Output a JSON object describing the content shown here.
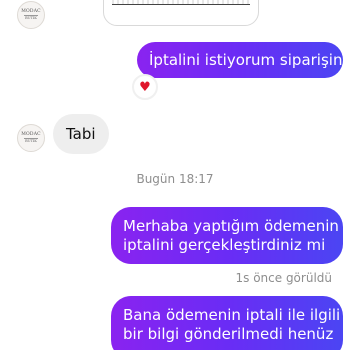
{
  "contact": {
    "avatar_icon": "brand-logo-avatar-icon",
    "avatar_wordmark_top": "MODAC",
    "avatar_wordmark_bottom": "BUTIK"
  },
  "shared_post": {
    "icon": "shared-post-preview"
  },
  "messages": [
    {
      "direction": "outgoing",
      "text": "İptalini istiyorum siparişin",
      "reaction_icon": "heart-icon",
      "reaction": "♥"
    },
    {
      "direction": "incoming",
      "text": "Tabi"
    },
    {
      "direction": "divider",
      "text": "Bugün 18:17"
    },
    {
      "direction": "outgoing",
      "lines": [
        "Merhaba yaptığım ödemenin",
        "iptalini gerçekleştirdiniz mi"
      ]
    },
    {
      "direction": "status",
      "text": "1s önce görüldü"
    },
    {
      "direction": "outgoing",
      "lines": [
        "Bana ödemenin iptali ile ilgili",
        "bir bilgi gönderilmedi henüz"
      ]
    }
  ],
  "colors": {
    "outgoing_gradient_start": "#8a23f0",
    "outgoing_gradient_end": "#4b45f3",
    "incoming_bubble": "#eeeeee",
    "meta_text": "#8e8e8e",
    "reaction": "#e0162b"
  }
}
